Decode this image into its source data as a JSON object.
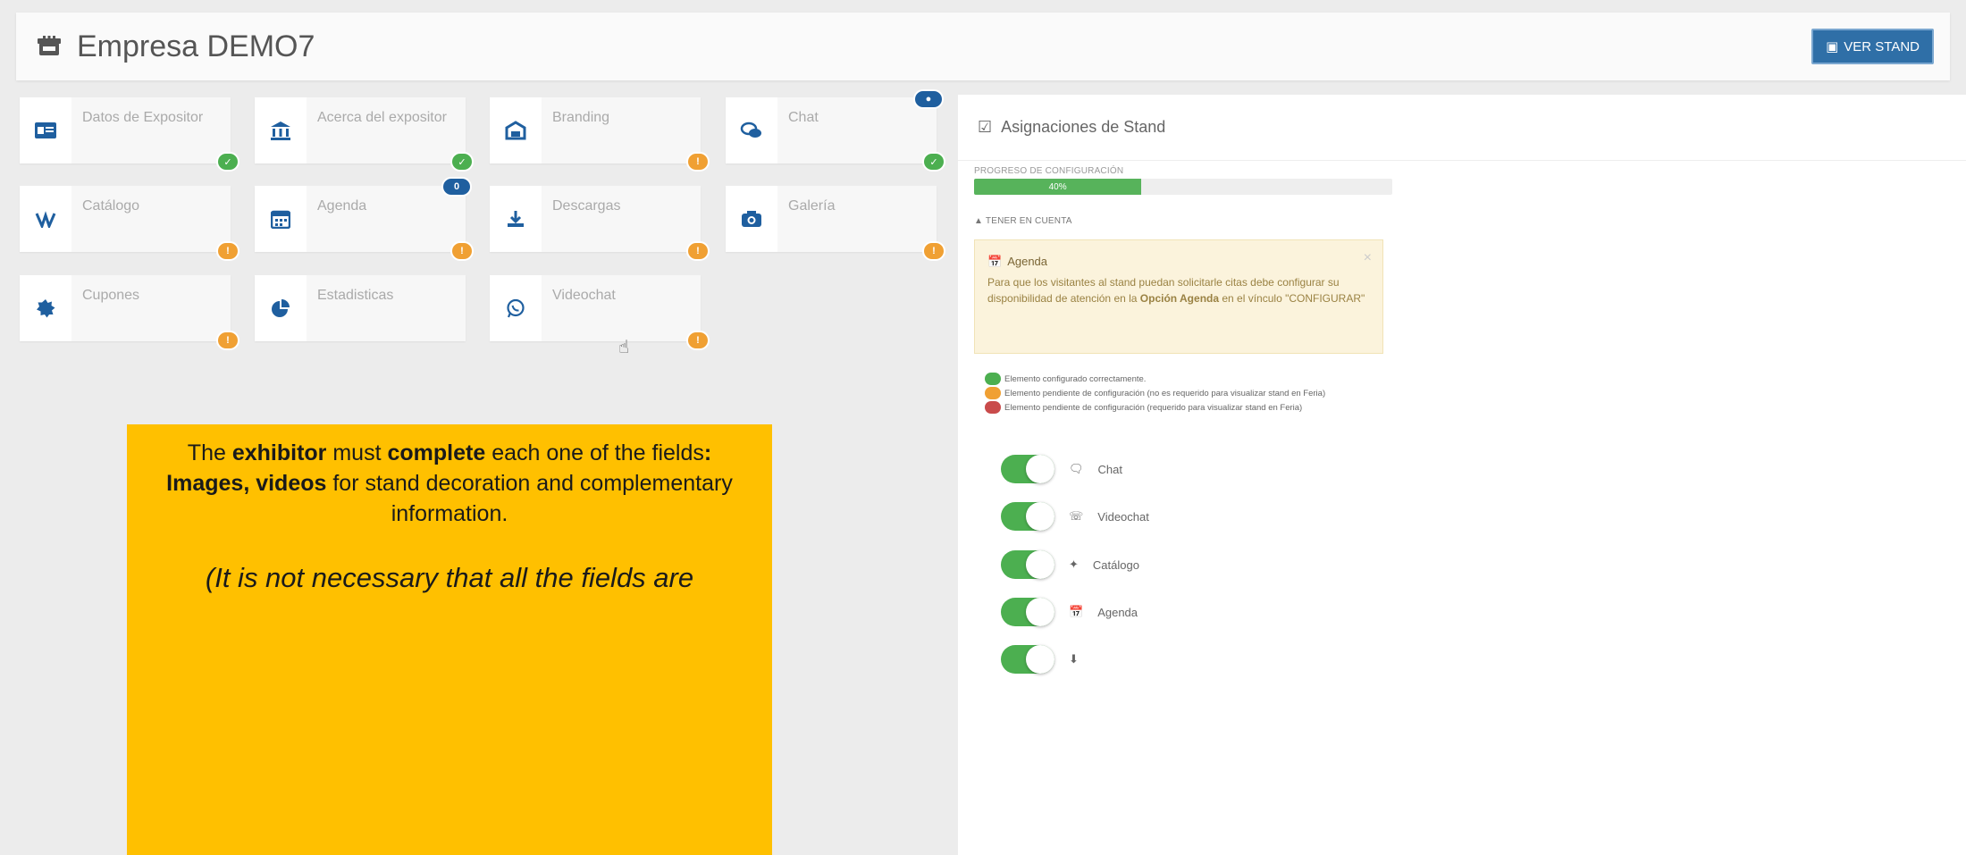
{
  "header": {
    "title": "Empresa DEMO7",
    "ver_stand": "VER STAND"
  },
  "tiles": [
    {
      "label": "Datos de Expositor",
      "icon": "id-card-icon",
      "status": "green"
    },
    {
      "label": "Acerca del expositor",
      "icon": "institution-icon",
      "status": "green"
    },
    {
      "label": "Branding",
      "icon": "branding-icon",
      "status": "orange"
    },
    {
      "label": "Chat",
      "icon": "chat-icon",
      "status": "green"
    },
    {
      "label": "Catálogo",
      "icon": "catalog-icon",
      "status": "orange"
    },
    {
      "label": "Agenda",
      "icon": "calendar-icon",
      "status": "orange"
    },
    {
      "label": "Descargas",
      "icon": "download-icon",
      "status": "orange"
    },
    {
      "label": "Galería",
      "icon": "camera-icon",
      "status": "orange"
    },
    {
      "label": "Cupones",
      "icon": "coupon-icon",
      "status": "orange"
    },
    {
      "label": "Estadisticas",
      "icon": "pie-chart-icon",
      "status": "none"
    },
    {
      "label": "Videochat",
      "icon": "whatsapp-icon",
      "status": "orange"
    }
  ],
  "tiles_counter_badge": "0",
  "panel": {
    "title": "Asignaciones de Stand",
    "progress_label": "PROGRESO DE CONFIGURACIÓN",
    "progress_value": "40%",
    "progress_fraction": 0.4,
    "tener_en_cuenta": "TENER EN CUENTA",
    "note_title": "Agenda",
    "note_text_1": "Para que los visitantes al stand puedan solicitarle citas debe configurar su disponibilidad de atención en la ",
    "note_bold": "Opción Agenda",
    "note_text_2": " en el vínculo \"CONFIGURAR\"",
    "note_close": "×",
    "legend": [
      {
        "text": "Elemento configurado correctamente.",
        "color": "#4caf50"
      },
      {
        "text": "Elemento pendiente de configuración (no es requerido para visualizar stand en Feria)",
        "color": "#f0a033"
      },
      {
        "text": "Elemento pendiente de configuración (requerido para visualizar stand en Feria)",
        "color": "#c94b4b"
      }
    ],
    "toggles": [
      {
        "label": "Chat",
        "icon": "chat-icon"
      },
      {
        "label": "Videochat",
        "icon": "whatsapp-icon"
      },
      {
        "label": "Catálogo",
        "icon": "catalog-icon"
      },
      {
        "label": "Agenda",
        "icon": "calendar-icon"
      },
      {
        "label": "",
        "icon": "download-icon"
      }
    ]
  },
  "callout": {
    "line1_pre": "The ",
    "line1_b1": "exhibitor",
    "line1_mid": " must ",
    "line1_b2": "complete",
    "line1_post": " each one of the fields",
    "line1_colon": ":",
    "line2_b": "Images, videos",
    "line2_post": " for stand decoration and complementary information.",
    "line3": "(It is not necessary that all the fields are"
  },
  "colors": {
    "primary": "#2f6fa7",
    "green": "#4caf50",
    "orange": "#f0a033",
    "callout": "#ffc000"
  }
}
